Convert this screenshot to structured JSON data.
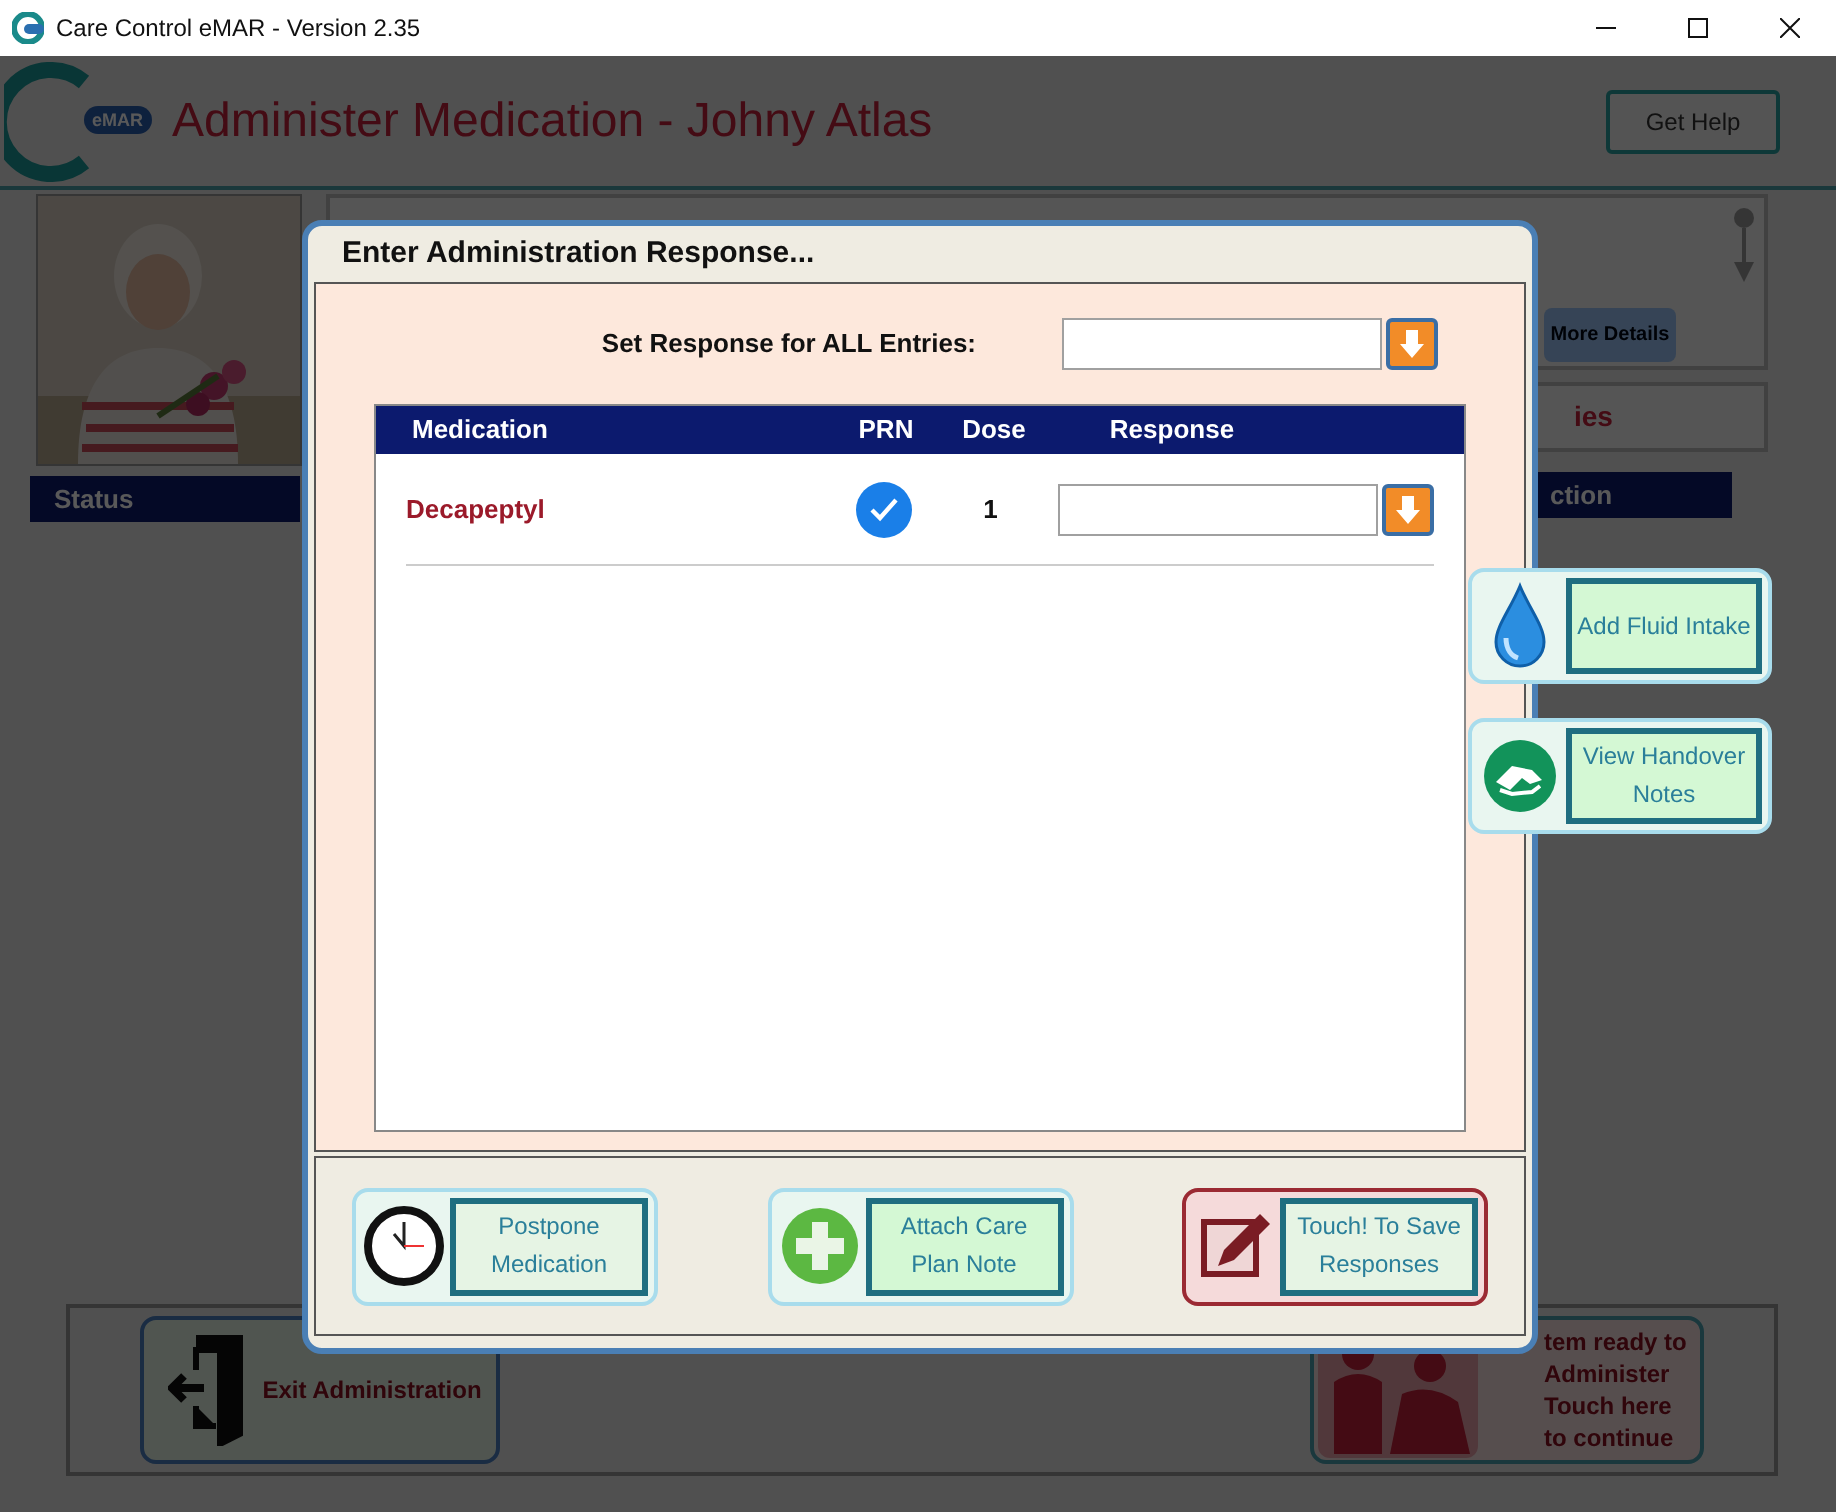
{
  "window": {
    "title": "Care Control eMAR - Version 2.35"
  },
  "header": {
    "logo_badge": "eMAR",
    "title": "Administer Medication - Johny Atlas",
    "help_button": "Get Help"
  },
  "resident_panel": {
    "details_button": "More Details"
  },
  "tab_fragment": "ies",
  "status_header": "Status",
  "action_header": "ction",
  "bottom": {
    "exit_button": "Exit Administration",
    "ready_button": "tem ready to Administer Touch here to continue"
  },
  "dialog": {
    "title": "Enter Administration Response...",
    "set_all_label": "Set Response for ALL Entries:",
    "table": {
      "columns": [
        "Medication",
        "PRN",
        "Dose",
        "Response"
      ],
      "rows": [
        {
          "medication": "Decapeptyl",
          "prn": true,
          "dose": "1"
        }
      ]
    },
    "buttons": [
      {
        "kind": "clock",
        "label": "Postpone Medication"
      },
      {
        "kind": "plus",
        "label": "Attach Care Plan Note"
      },
      {
        "kind": "save",
        "label": "Touch! To Save Responses"
      }
    ]
  },
  "side_buttons": [
    {
      "kind": "drop",
      "label": "Add Fluid Intake"
    },
    {
      "kind": "handover",
      "label": "View Handover Notes"
    }
  ]
}
